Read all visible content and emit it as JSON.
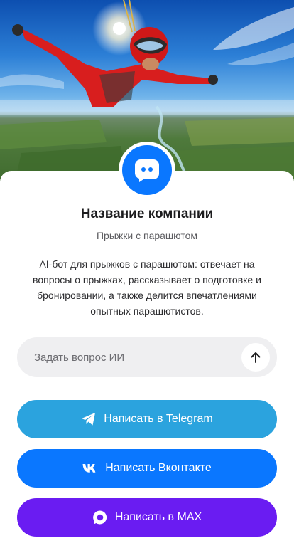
{
  "hero": {
    "image": "skydiver-in-red-suit-freefall-over-landscape"
  },
  "profile": {
    "avatar_icon": "chat-bot-icon",
    "company_name": "Название компании",
    "category": "Прыжки с парашютом",
    "description": "AI-бот для прыжков с парашютом: отвечает на вопросы о прыжках, рассказывает о подготовке и бронировании, а также делится впечатлениями опытных парашютистов."
  },
  "ask": {
    "placeholder": "Задать вопрос ИИ",
    "value": "",
    "send_icon": "arrow-up-icon"
  },
  "buttons": {
    "telegram_label": "Написать в Telegram",
    "vk_label": "Написать Вконтакте",
    "max_label": "Написать в MAX"
  },
  "colors": {
    "accent": "#0a77ff",
    "telegram": "#2ba3de",
    "vk": "#0a77ff",
    "max": "#6a1cf2",
    "input_bg": "#efeff1"
  }
}
